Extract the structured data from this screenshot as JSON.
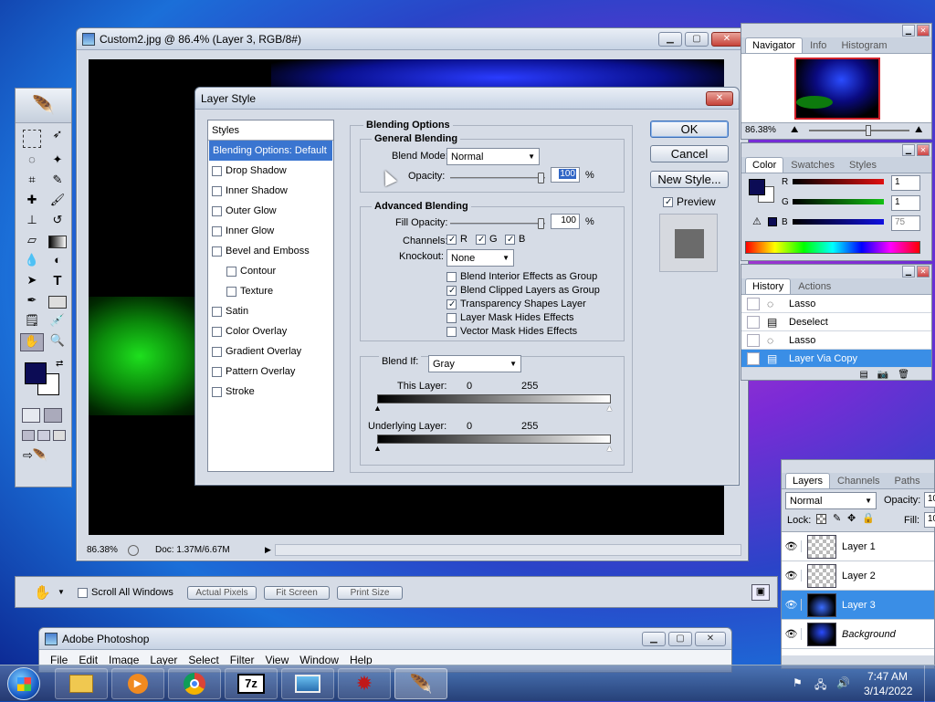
{
  "doc_window": {
    "title": "Custom2.jpg @ 86.4% (Layer 3, RGB/8#)",
    "zoom": "86.38%",
    "doc_info": "Doc: 1.37M/6.67M"
  },
  "toolbox": {
    "fg_color": "#0c0c55",
    "bg_color": "#ffffff"
  },
  "layer_style": {
    "title": "Layer Style",
    "styles_header": "Styles",
    "styles": [
      {
        "label": "Blending Options: Default",
        "checkbox": false,
        "selected": true,
        "indent": false
      },
      {
        "label": "Drop Shadow",
        "checkbox": true,
        "checked": false,
        "indent": false
      },
      {
        "label": "Inner Shadow",
        "checkbox": true,
        "checked": false,
        "indent": false
      },
      {
        "label": "Outer Glow",
        "checkbox": true,
        "checked": false,
        "indent": false
      },
      {
        "label": "Inner Glow",
        "checkbox": true,
        "checked": false,
        "indent": false
      },
      {
        "label": "Bevel and Emboss",
        "checkbox": true,
        "checked": false,
        "indent": false
      },
      {
        "label": "Contour",
        "checkbox": true,
        "checked": false,
        "indent": true
      },
      {
        "label": "Texture",
        "checkbox": true,
        "checked": false,
        "indent": true
      },
      {
        "label": "Satin",
        "checkbox": true,
        "checked": false,
        "indent": false
      },
      {
        "label": "Color Overlay",
        "checkbox": true,
        "checked": false,
        "indent": false
      },
      {
        "label": "Gradient Overlay",
        "checkbox": true,
        "checked": false,
        "indent": false
      },
      {
        "label": "Pattern Overlay",
        "checkbox": true,
        "checked": false,
        "indent": false
      },
      {
        "label": "Stroke",
        "checkbox": true,
        "checked": false,
        "indent": false
      }
    ],
    "blending_options_label": "Blending Options",
    "general_blending_label": "General Blending",
    "blend_mode_label": "Blend Mode:",
    "blend_mode_value": "Normal",
    "opacity_label": "Opacity:",
    "opacity_value": "100",
    "percent": "%",
    "advanced_blending_label": "Advanced Blending",
    "fill_opacity_label": "Fill Opacity:",
    "fill_opacity_value": "100",
    "channels_label": "Channels:",
    "channel_r": "R",
    "channel_g": "G",
    "channel_b": "B",
    "knockout_label": "Knockout:",
    "knockout_value": "None",
    "adv_options": [
      {
        "label": "Blend Interior Effects as Group",
        "checked": false
      },
      {
        "label": "Blend Clipped Layers as Group",
        "checked": true
      },
      {
        "label": "Transparency Shapes Layer",
        "checked": true
      },
      {
        "label": "Layer Mask Hides Effects",
        "checked": false
      },
      {
        "label": "Vector Mask Hides Effects",
        "checked": false
      }
    ],
    "blend_if_label": "Blend If:",
    "blend_if_value": "Gray",
    "this_layer_label": "This Layer:",
    "this_layer_min": "0",
    "this_layer_max": "255",
    "underlying_layer_label": "Underlying Layer:",
    "underlying_min": "0",
    "underlying_max": "255",
    "ok_label": "OK",
    "cancel_label": "Cancel",
    "new_style_label": "New Style...",
    "preview_label": "Preview"
  },
  "navigator": {
    "tabs": [
      "Navigator",
      "Info",
      "Histogram"
    ],
    "zoom": "86.38%"
  },
  "color_palette": {
    "tabs": [
      "Color",
      "Swatches",
      "Styles"
    ],
    "r_label": "R",
    "g_label": "G",
    "b_label": "B",
    "r_value": "1",
    "g_value": "1",
    "b_value": "75"
  },
  "history": {
    "tabs": [
      "History",
      "Actions"
    ],
    "items": [
      "Lasso",
      "Deselect",
      "Lasso",
      "Layer Via Copy"
    ],
    "selected_index": 3
  },
  "layers": {
    "tabs": [
      "Layers",
      "Channels",
      "Paths"
    ],
    "blend_mode": "Normal",
    "opacity_label": "Opacity:",
    "opacity_value": "10",
    "lock_label": "Lock:",
    "fill_label": "Fill:",
    "fill_value": "10",
    "items": [
      "Layer 1",
      "Layer 2",
      "Layer 3",
      "Background"
    ],
    "selected_index": 2
  },
  "options_bar": {
    "scroll_all_label": "Scroll All Windows",
    "actual_pixels": "Actual Pixels",
    "fit_screen": "Fit Screen",
    "print_size": "Print Size"
  },
  "ps_app": {
    "title": "Adobe Photoshop",
    "menus": [
      "File",
      "Edit",
      "Image",
      "Layer",
      "Select",
      "Filter",
      "View",
      "Window",
      "Help"
    ]
  },
  "taskbar": {
    "time": "7:47 AM",
    "date": "3/14/2022"
  }
}
